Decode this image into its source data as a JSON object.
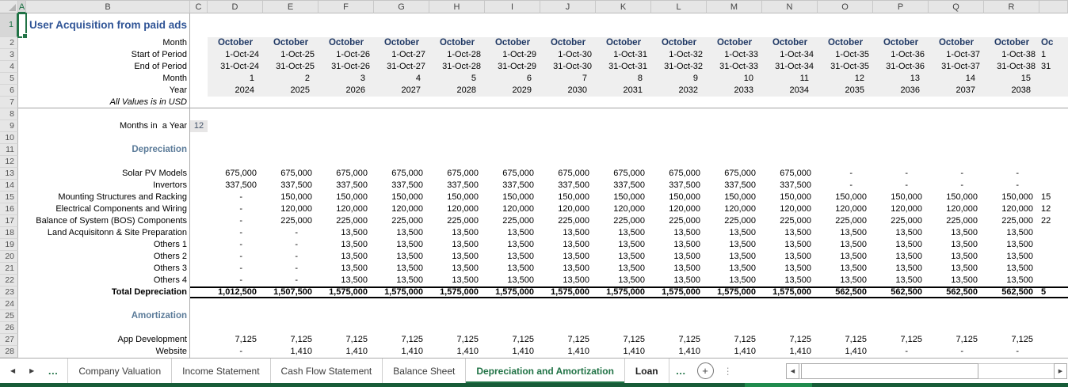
{
  "sheet": {
    "title": "User Acquisition from paid ads",
    "col_letters": [
      "A",
      "B",
      "C",
      "D",
      "E",
      "F",
      "G",
      "H",
      "I",
      "J",
      "K",
      "L",
      "M",
      "N",
      "O",
      "P",
      "Q",
      "R"
    ],
    "colors": {
      "accent_green": "#217346",
      "title_blue": "#2F5496",
      "month_header_navy": "#1F3864",
      "section_blue_gray": "#5B7B99",
      "bottom_strip_green": "#175C38"
    },
    "periods": [
      {
        "month": "October",
        "start": "1-Oct-24",
        "end": "31-Oct-24",
        "num": "1",
        "year": "2024"
      },
      {
        "month": "October",
        "start": "1-Oct-25",
        "end": "31-Oct-25",
        "num": "2",
        "year": "2025"
      },
      {
        "month": "October",
        "start": "1-Oct-26",
        "end": "31-Oct-26",
        "num": "3",
        "year": "2026"
      },
      {
        "month": "October",
        "start": "1-Oct-27",
        "end": "31-Oct-27",
        "num": "4",
        "year": "2027"
      },
      {
        "month": "October",
        "start": "1-Oct-28",
        "end": "31-Oct-28",
        "num": "5",
        "year": "2028"
      },
      {
        "month": "October",
        "start": "1-Oct-29",
        "end": "31-Oct-29",
        "num": "6",
        "year": "2029"
      },
      {
        "month": "October",
        "start": "1-Oct-30",
        "end": "31-Oct-30",
        "num": "7",
        "year": "2030"
      },
      {
        "month": "October",
        "start": "1-Oct-31",
        "end": "31-Oct-31",
        "num": "8",
        "year": "2031"
      },
      {
        "month": "October",
        "start": "1-Oct-32",
        "end": "31-Oct-32",
        "num": "9",
        "year": "2032"
      },
      {
        "month": "October",
        "start": "1-Oct-33",
        "end": "31-Oct-33",
        "num": "10",
        "year": "2033"
      },
      {
        "month": "October",
        "start": "1-Oct-34",
        "end": "31-Oct-34",
        "num": "11",
        "year": "2034"
      },
      {
        "month": "October",
        "start": "1-Oct-35",
        "end": "31-Oct-35",
        "num": "12",
        "year": "2035"
      },
      {
        "month": "October",
        "start": "1-Oct-36",
        "end": "31-Oct-36",
        "num": "13",
        "year": "2036"
      },
      {
        "month": "October",
        "start": "1-Oct-37",
        "end": "31-Oct-37",
        "num": "14",
        "year": "2037"
      },
      {
        "month": "October",
        "start": "1-Oct-38",
        "end": "31-Oct-38",
        "num": "15",
        "year": "2038"
      }
    ],
    "partial_column": {
      "month": "Oc",
      "start": "1",
      "end": "31"
    },
    "rows": [
      {
        "n": 1,
        "label": "User Acquisition from paid ads",
        "style": "title"
      },
      {
        "n": 2,
        "label": "Month",
        "style": "period",
        "field": "month"
      },
      {
        "n": 3,
        "label": "Start of Period",
        "style": "period",
        "field": "start"
      },
      {
        "n": 4,
        "label": "End of Period",
        "style": "period",
        "field": "end"
      },
      {
        "n": 5,
        "label": "Month",
        "style": "period",
        "field": "num"
      },
      {
        "n": 6,
        "label": "Year",
        "style": "period",
        "field": "year"
      },
      {
        "n": 7,
        "label": "All Values is in USD",
        "style": "italic"
      },
      {
        "n": 8,
        "label": ""
      },
      {
        "n": 9,
        "label": "Months in  a Year",
        "c_value": "12"
      },
      {
        "n": 10,
        "label": ""
      },
      {
        "n": 11,
        "label": "Depreciation",
        "style": "section"
      },
      {
        "n": 12,
        "label": ""
      },
      {
        "n": 13,
        "label": "Solar PV Models",
        "values": [
          "675,000",
          "675,000",
          "675,000",
          "675,000",
          "675,000",
          "675,000",
          "675,000",
          "675,000",
          "675,000",
          "675,000",
          "675,000",
          "-",
          "-",
          "-",
          "-"
        ]
      },
      {
        "n": 14,
        "label": "Invertors",
        "values": [
          "337,500",
          "337,500",
          "337,500",
          "337,500",
          "337,500",
          "337,500",
          "337,500",
          "337,500",
          "337,500",
          "337,500",
          "337,500",
          "-",
          "-",
          "-",
          "-"
        ]
      },
      {
        "n": 15,
        "label": "Mounting Structures and Racking",
        "values": [
          "-",
          "150,000",
          "150,000",
          "150,000",
          "150,000",
          "150,000",
          "150,000",
          "150,000",
          "150,000",
          "150,000",
          "150,000",
          "150,000",
          "150,000",
          "150,000",
          "150,000"
        ],
        "partial": "15"
      },
      {
        "n": 16,
        "label": "Electrical Components and Wiring",
        "values": [
          "-",
          "120,000",
          "120,000",
          "120,000",
          "120,000",
          "120,000",
          "120,000",
          "120,000",
          "120,000",
          "120,000",
          "120,000",
          "120,000",
          "120,000",
          "120,000",
          "120,000"
        ],
        "partial": "12"
      },
      {
        "n": 17,
        "label": "Balance of System (BOS) Components",
        "values": [
          "-",
          "225,000",
          "225,000",
          "225,000",
          "225,000",
          "225,000",
          "225,000",
          "225,000",
          "225,000",
          "225,000",
          "225,000",
          "225,000",
          "225,000",
          "225,000",
          "225,000"
        ],
        "partial": "22"
      },
      {
        "n": 18,
        "label": "Land Acquisitonn & Site Preparation",
        "values": [
          "-",
          "-",
          "13,500",
          "13,500",
          "13,500",
          "13,500",
          "13,500",
          "13,500",
          "13,500",
          "13,500",
          "13,500",
          "13,500",
          "13,500",
          "13,500",
          "13,500"
        ]
      },
      {
        "n": 19,
        "label": "Others 1",
        "values": [
          "-",
          "-",
          "13,500",
          "13,500",
          "13,500",
          "13,500",
          "13,500",
          "13,500",
          "13,500",
          "13,500",
          "13,500",
          "13,500",
          "13,500",
          "13,500",
          "13,500"
        ]
      },
      {
        "n": 20,
        "label": "Others 2",
        "values": [
          "-",
          "-",
          "13,500",
          "13,500",
          "13,500",
          "13,500",
          "13,500",
          "13,500",
          "13,500",
          "13,500",
          "13,500",
          "13,500",
          "13,500",
          "13,500",
          "13,500"
        ]
      },
      {
        "n": 21,
        "label": "Others 3",
        "values": [
          "-",
          "-",
          "13,500",
          "13,500",
          "13,500",
          "13,500",
          "13,500",
          "13,500",
          "13,500",
          "13,500",
          "13,500",
          "13,500",
          "13,500",
          "13,500",
          "13,500"
        ]
      },
      {
        "n": 22,
        "label": "Others 4",
        "values": [
          "-",
          "-",
          "13,500",
          "13,500",
          "13,500",
          "13,500",
          "13,500",
          "13,500",
          "13,500",
          "13,500",
          "13,500",
          "13,500",
          "13,500",
          "13,500",
          "13,500"
        ]
      },
      {
        "n": 23,
        "label": "Total Depreciation",
        "style": "total",
        "values": [
          "1,012,500",
          "1,507,500",
          "1,575,000",
          "1,575,000",
          "1,575,000",
          "1,575,000",
          "1,575,000",
          "1,575,000",
          "1,575,000",
          "1,575,000",
          "1,575,000",
          "562,500",
          "562,500",
          "562,500",
          "562,500"
        ],
        "partial": "5"
      },
      {
        "n": 24,
        "label": ""
      },
      {
        "n": 25,
        "label": "Amortization",
        "style": "section"
      },
      {
        "n": 26,
        "label": ""
      },
      {
        "n": 27,
        "label": "App Development",
        "values": [
          "7,125",
          "7,125",
          "7,125",
          "7,125",
          "7,125",
          "7,125",
          "7,125",
          "7,125",
          "7,125",
          "7,125",
          "7,125",
          "7,125",
          "7,125",
          "7,125",
          "7,125"
        ]
      },
      {
        "n": 28,
        "label": "Website",
        "values": [
          "-",
          "1,410",
          "1,410",
          "1,410",
          "1,410",
          "1,410",
          "1,410",
          "1,410",
          "1,410",
          "1,410",
          "1,410",
          "1,410",
          "-",
          "-",
          "-"
        ]
      }
    ],
    "tabbar": {
      "nav_left": "◀",
      "nav_right": "▶",
      "more_left": "…",
      "more_right": "…",
      "add_sheet": "+",
      "vdots": "⋮",
      "scroll_left": "◀",
      "scroll_right": "▶",
      "tabs": [
        {
          "label": "Company Valuation"
        },
        {
          "label": "Income Statement"
        },
        {
          "label": "Cash Flow Statement"
        },
        {
          "label": "Balance Sheet"
        },
        {
          "label": "Depreciation and Amortization",
          "active": true
        },
        {
          "label": "Loan",
          "bold": true
        }
      ]
    }
  }
}
